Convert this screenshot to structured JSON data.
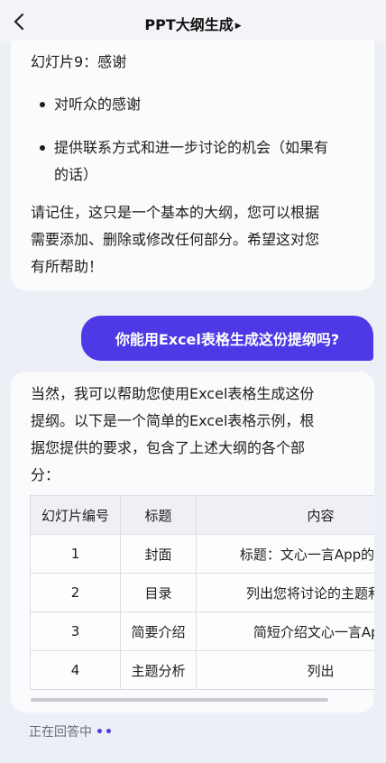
{
  "header": {
    "title": "PPT大纲生成"
  },
  "answer1": {
    "heading": "幻灯片9：感谢",
    "bullets": [
      "对听众的感谢",
      "提供联系方式和进一步讨论的机会（如果有",
      "的话）"
    ],
    "closing": [
      "请记住，这只是一个基本的大纲，您可以根据",
      "需要添加、删除或修改任何部分。希望这对您",
      "有所帮助！"
    ]
  },
  "user_message": "你能用Excel表格生成这份提纲吗?",
  "answer2": {
    "intro": [
      "当然，我可以帮助您使用Excel表格生成这份",
      "提纲。以下是一个简单的Excel表格示例，根",
      "据您提供的要求，包含了上述大纲的各个部",
      "分："
    ],
    "table": {
      "headers": [
        "幻灯片编号",
        "标题",
        "内容"
      ],
      "rows": [
        [
          "1",
          "封面",
          "标题：文心一言App的深度"
        ],
        [
          "2",
          "目录",
          "列出您将讨论的主题和重"
        ],
        [
          "3",
          "简要介绍",
          "简短介绍文心一言App"
        ],
        [
          "4",
          "主题分析",
          "列出"
        ]
      ]
    }
  },
  "status": {
    "text": "正在回答中",
    "dots": "••"
  },
  "icons": {
    "back": "chevron-left-icon",
    "title_caret": "caret-right-icon"
  }
}
